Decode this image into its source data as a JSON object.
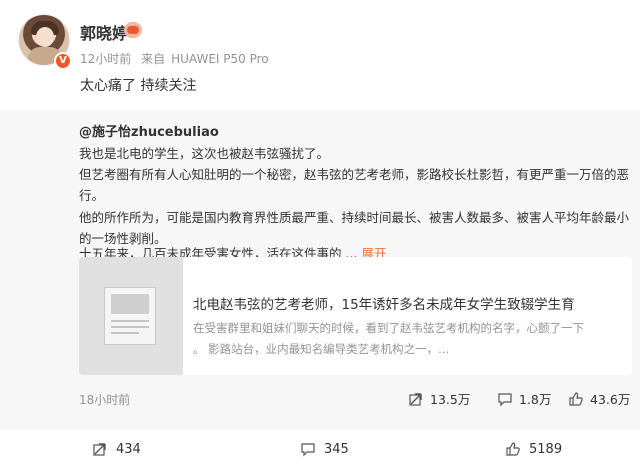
{
  "post": {
    "username": "郭晓婷",
    "time": "12小时前",
    "source_prefix": "来自",
    "source_device": "HUAWEI P50 Pro",
    "text": "太心痛了 持续关注"
  },
  "retweet": {
    "author": "@施子怡zhucebuliao",
    "lines": [
      "我也是北电的学生，这次也被赵韦弦骚扰了。",
      "但艺考圈有所有人心知肚明的一个秘密，赵韦弦的艺考老师，影路校长杜影哲，有更严重一万倍的恶",
      "行。",
      "他的所作所为，可能是国内教育界性质最严重、持续时间最长、被害人数最多、被害人平均年龄最小",
      "的一场性剥削。",
      "十五年来，几百未成年受害女性，活在这件事的 ..."
    ],
    "expand_label": "展开",
    "card": {
      "title": "北电赵韦弦的艺考老师，15年诱奸多名未成年女学生致辍学生育",
      "desc_line1": "在受害群里和姐妹们聊天的时候，看到了赵韦弦艺考机构的名字，心颤了一下",
      "desc_line2": "。 影路站台，业内最知名编导类艺考机构之一，..."
    },
    "time": "18小时前",
    "reposts": "13.5万",
    "comments": "1.8万",
    "likes": "43.6万"
  },
  "actions": {
    "reposts": "434",
    "comments": "345",
    "likes": "5189"
  },
  "colors": {
    "accent": "#eb7340",
    "meta": "#939393",
    "retweet_bg": "#f7f7f7"
  }
}
